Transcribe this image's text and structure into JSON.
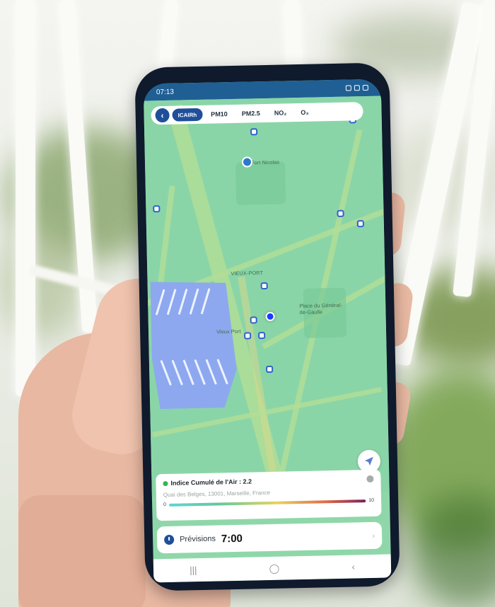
{
  "phone": {
    "status": {
      "time": "07:13"
    },
    "toolbar": {
      "back_icon": "chevron-left-icon",
      "chips": [
        {
          "label": "ICAIRh",
          "active": true
        },
        {
          "label": "PM10",
          "active": false
        },
        {
          "label": "PM2.5",
          "active": false
        },
        {
          "label": "NO₂",
          "active": false
        },
        {
          "label": "O₃",
          "active": false
        }
      ]
    },
    "map": {
      "labels": {
        "poi_top": "Fort Nicolas",
        "quarter": "VIEUX-PORT",
        "place": "Place du Général-de-Gaulle",
        "vieux_port": "Vieux Port"
      },
      "locate_icon": "navigation-arrow-icon"
    },
    "info_card": {
      "title": "Indice Cumulé de l'Air : 2.2",
      "address": "Quai des Belges, 13001, Marseille, France",
      "scale_min": "0",
      "scale_max": "10",
      "info_icon": "info-icon"
    },
    "forecast": {
      "label": "Prévisions",
      "time": "7:00",
      "clock_icon": "clock-icon",
      "arrow_icon": "chevron-right-icon"
    },
    "navbar": {
      "recents": "|||",
      "home": "◯",
      "back": "‹"
    }
  },
  "colors": {
    "accent": "#1f4f9a",
    "map_green": "#8ad5a8",
    "zone_blue": "#8da8ef",
    "status_bar": "#1f5f94"
  }
}
